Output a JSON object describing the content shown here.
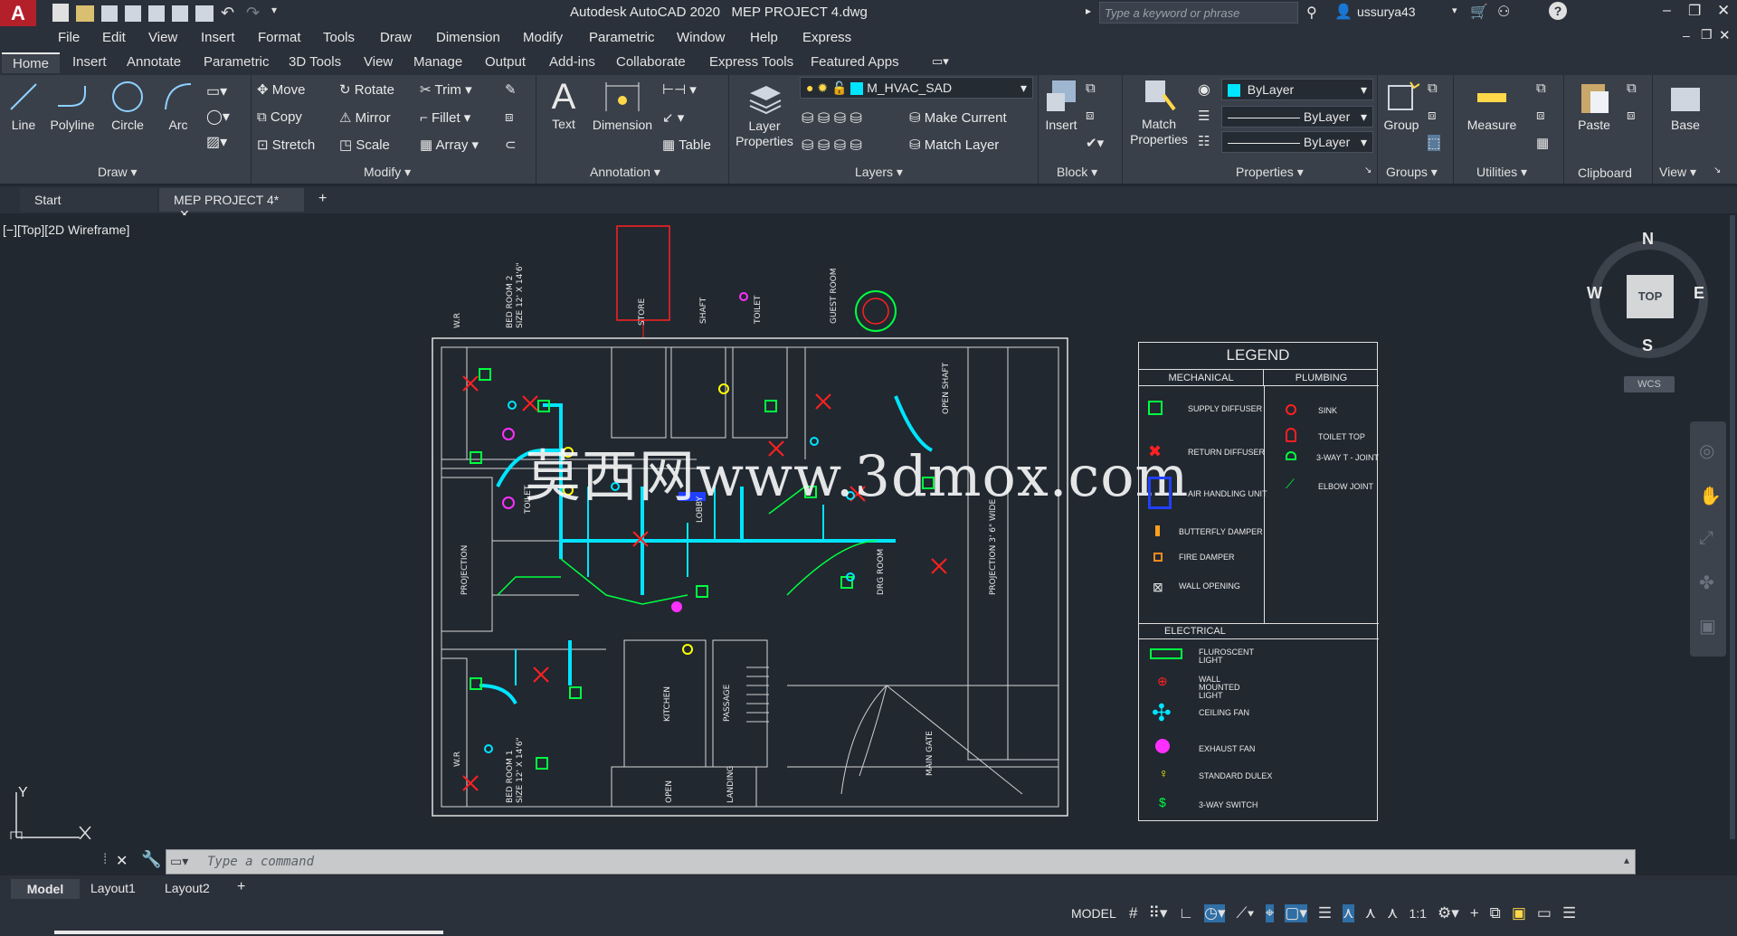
{
  "app": {
    "title": "Autodesk AutoCAD 2020",
    "document": "MEP PROJECT 4.dwg"
  },
  "search": {
    "placeholder": "Type a keyword or phrase"
  },
  "user": {
    "name": "ussurya43"
  },
  "menu": [
    "File",
    "Edit",
    "View",
    "Insert",
    "Format",
    "Tools",
    "Draw",
    "Dimension",
    "Modify",
    "Parametric",
    "Window",
    "Help",
    "Express"
  ],
  "ribbon_tabs": [
    "Home",
    "Insert",
    "Annotate",
    "Parametric",
    "3D Tools",
    "View",
    "Manage",
    "Output",
    "Add-ins",
    "Collaborate",
    "Express Tools",
    "Featured Apps"
  ],
  "ribbon": {
    "draw": {
      "line": "Line",
      "polyline": "Polyline",
      "circle": "Circle",
      "arc": "Arc",
      "panel": "Draw"
    },
    "modify": {
      "move": "Move",
      "rotate": "Rotate",
      "trim": "Trim",
      "copy": "Copy",
      "mirror": "Mirror",
      "fillet": "Fillet",
      "stretch": "Stretch",
      "scale": "Scale",
      "array": "Array",
      "panel": "Modify"
    },
    "annotation": {
      "text": "Text",
      "dimension": "Dimension",
      "table": "Table",
      "panel": "Annotation"
    },
    "layers": {
      "layer_properties": "Layer Properties",
      "current_layer": "M_HVAC_SAD",
      "make_current": "Make Current",
      "match_layer": "Match Layer",
      "panel": "Layers"
    },
    "block": {
      "insert": "Insert",
      "panel": "Block"
    },
    "properties": {
      "match": "Match Properties",
      "color": "ByLayer",
      "linetype": "ByLayer",
      "lineweight": "ByLayer",
      "panel": "Properties"
    },
    "groups": {
      "group": "Group",
      "panel": "Groups"
    },
    "utilities": {
      "measure": "Measure",
      "panel": "Utilities"
    },
    "clipboard": {
      "paste": "Paste",
      "panel": "Clipboard"
    },
    "view": {
      "base": "Base",
      "panel": "View"
    }
  },
  "file_tabs": {
    "start": "Start",
    "current": "MEP PROJECT 4*"
  },
  "viewport": {
    "label": "[−][Top][2D Wireframe]"
  },
  "viewcube": {
    "n": "N",
    "s": "S",
    "e": "E",
    "w": "W",
    "top": "TOP",
    "wcs": "WCS"
  },
  "ucs": {
    "y": "Y"
  },
  "watermark": "莫西网www.3dmox.com",
  "plan": {
    "rooms": [
      "W.R",
      "BED ROOM 2",
      "SIZE 12' X 14'6\"",
      "STORE",
      "SHAFT",
      "TOILET",
      "GUEST ROOM",
      "OPEN SHAFT",
      "PROJECTION",
      "TOILET",
      "LOBBY",
      "DRG ROOM",
      "PROJECTION 3' 6\" WIDE",
      "W.R",
      "BED ROOM 1",
      "SIZE 12' X 14'6\"",
      "KITCHEN",
      "PASSAGE",
      "LANDING",
      "OPEN",
      "MAIN GATE"
    ]
  },
  "legend": {
    "title": "LEGEND",
    "mechanical_header": "MECHANICAL",
    "plumbing_header": "PLUMBING",
    "electrical_header": "ELECTRICAL",
    "mechanical": [
      "SUPPLY DIFFUSER",
      "RETURN DIFFUSER",
      "AIR HANDLING UNIT",
      "BUTTERFLY DAMPER",
      "FIRE DAMPER",
      "WALL OPENING"
    ],
    "plumbing": [
      "SINK",
      "TOILET TOP",
      "3-WAY T - JOINT",
      "ELBOW JOINT"
    ],
    "electrical": [
      "FLUROSCENT LIGHT",
      "WALL MOUNTED LIGHT",
      "CEILING FAN",
      "EXHAUST FAN",
      "STANDARD DULEX",
      "3-WAY SWITCH"
    ]
  },
  "command": {
    "placeholder": "Type a command"
  },
  "layout_tabs": [
    "Model",
    "Layout1",
    "Layout2"
  ],
  "status": {
    "model": "MODEL",
    "scale": "1:1"
  },
  "colors": {
    "accent": "#0e8fd6",
    "bg": "#212830",
    "cyan": "#00e5ff",
    "green": "#00ff40",
    "red": "#ff2020",
    "yellow": "#ffff00",
    "magenta": "#ff30ff"
  }
}
